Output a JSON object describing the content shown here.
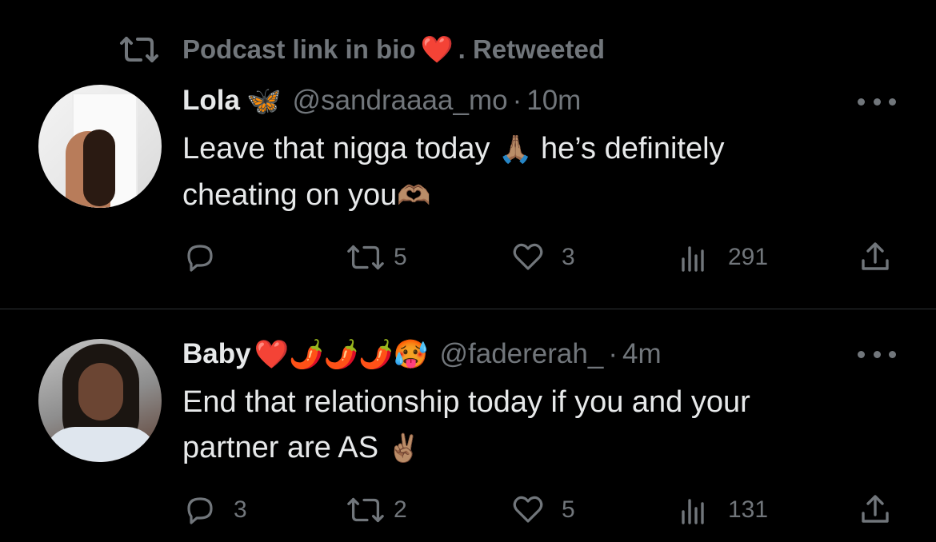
{
  "social_context": {
    "text": "Podcast link in bio",
    "emoji": "❤️",
    "suffix": ". Retweeted"
  },
  "tweets": [
    {
      "name": "Lola",
      "name_emoji": "🦋",
      "handle": "@sandraaaa_mo",
      "separator": "·",
      "time": "10m",
      "text_line1": "Leave that nigga today",
      "text_line1_emoji": "🙏🏽",
      "text_line1_rest": "he’s definitely",
      "text_line2": "cheating on you",
      "text_line2_emoji": "🫶🏽",
      "actions": {
        "replies": "",
        "retweets": "5",
        "likes": "3",
        "views": "291"
      }
    },
    {
      "name": "Baby",
      "name_emoji": "❤️🌶️🌶️🌶️🥵",
      "handle": "@fadererah_",
      "separator": "·",
      "time": "4m",
      "text_line1": "End that relationship today if you and your",
      "text_line2": "partner are AS",
      "text_line2_emoji": "✌🏽",
      "actions": {
        "replies": "3",
        "retweets": "2",
        "likes": "5",
        "views": "131"
      }
    }
  ],
  "icons": {
    "retweet": "retweet-icon",
    "reply": "reply-icon",
    "like": "heart-icon",
    "views": "views-icon",
    "share": "share-icon",
    "more": "more-icon"
  },
  "colors": {
    "background": "#000000",
    "text": "#e7e9ea",
    "muted": "#71767b",
    "divider": "#2f3336"
  }
}
